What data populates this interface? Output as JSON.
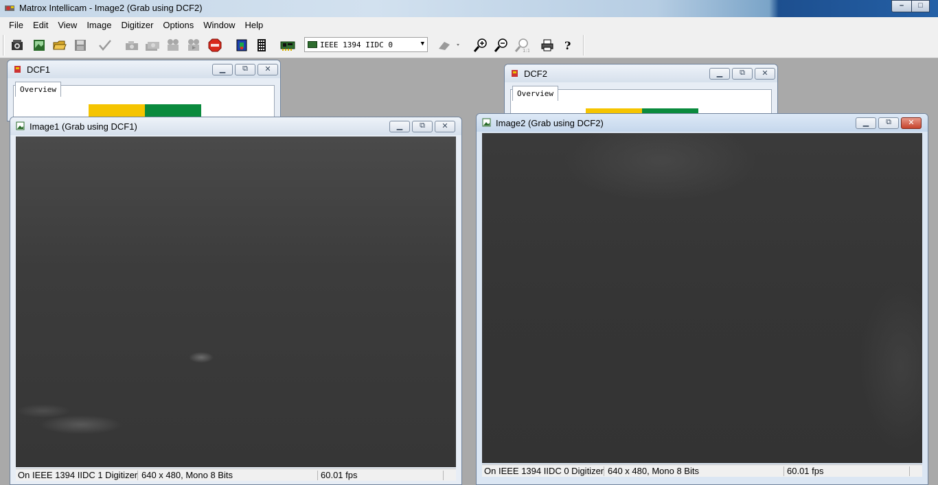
{
  "app": {
    "title": "Matrox Intellicam - Image2 (Grab using DCF2)",
    "controls": {
      "minimize": "–",
      "maximize": "□"
    }
  },
  "menu": [
    "File",
    "Edit",
    "View",
    "Image",
    "Digitizer",
    "Options",
    "Window",
    "Help"
  ],
  "toolbar": {
    "digitizer_combo": "IEEE 1394 IIDC 0",
    "icons": [
      "new-camera-icon",
      "open-image-icon",
      "open-folder-icon",
      "save-icon",
      "check-icon",
      "grab-icon",
      "grab-multiple-icon",
      "record-icon",
      "playback-icon",
      "stop-icon",
      "display-color-icon",
      "grid-icon",
      "digitizer-board-icon",
      "eraser-icon",
      "zoom-in-icon",
      "zoom-out-icon",
      "zoom-reset-icon",
      "print-icon",
      "help-icon"
    ]
  },
  "windows": {
    "dcf1": {
      "title": "DCF1",
      "tab": "Overview",
      "colors": {
        "yellow": "#f5c400",
        "green": "#0a8a3d"
      }
    },
    "dcf2": {
      "title": "DCF2",
      "tab": "Overview"
    },
    "image1": {
      "title": "Image1 (Grab using DCF1)",
      "status": {
        "digitizer": "On IEEE 1394 IIDC 1 Digitizer",
        "format": "640 x 480, Mono 8 Bits",
        "fps": "60.01 fps"
      }
    },
    "image2": {
      "title": "Image2 (Grab using DCF2)",
      "status": {
        "digitizer": "On IEEE 1394 IIDC 0 Digitizer",
        "format": "640 x 480, Mono 8 Bits",
        "fps": "60.01 fps"
      }
    }
  },
  "window_controls": {
    "minimize": "▁",
    "restore": "⧉",
    "close": "✕"
  }
}
